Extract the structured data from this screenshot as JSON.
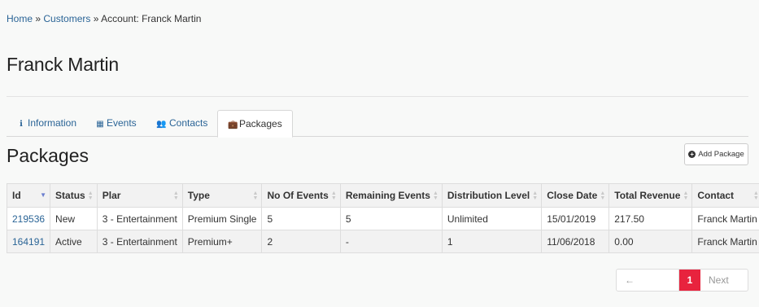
{
  "breadcrumb": {
    "home": "Home",
    "sep1": " » ",
    "customers": "Customers",
    "sep2": " » ",
    "current": "Account: Franck Martin"
  },
  "page_title": "Franck Martin",
  "tabs": [
    {
      "label": "Information",
      "icon": "info-circle-icon",
      "glyph": "ℹ"
    },
    {
      "label": "Events",
      "icon": "calendar-icon",
      "glyph": "▦"
    },
    {
      "label": "Contacts",
      "icon": "users-icon",
      "glyph": "👥"
    },
    {
      "label": "Packages",
      "icon": "briefcase-icon",
      "glyph": "💼"
    }
  ],
  "active_tab": "Packages",
  "section_title": "Packages",
  "add_button": {
    "label": "Add Package",
    "plus": "+"
  },
  "table": {
    "columns": [
      "Id",
      "Status",
      "Plar",
      "Type",
      "No Of Events",
      "Remaining Events",
      "Distribution Level",
      "Close Date",
      "Total Revenue",
      "Contact"
    ],
    "sort_glyph": "▲▼",
    "active_sort_glyph": "▼",
    "rows": [
      [
        "219536",
        "New",
        "3 - Entertainment",
        "Premium Single",
        "5",
        "5",
        "Unlimited",
        "15/01/2019",
        "217.50",
        "Franck Martin"
      ],
      [
        "164191",
        "Active",
        "3 - Entertainment",
        "Premium+",
        "2",
        "-",
        "1",
        "11/06/2018",
        "0.00",
        "Franck Martin"
      ]
    ]
  },
  "pagination": {
    "previous": "← Previous",
    "current": "1",
    "next": "Next →"
  },
  "colors": {
    "link": "#2a6496",
    "accent": "#e8233e",
    "sort_active": "#6b7ecf"
  }
}
